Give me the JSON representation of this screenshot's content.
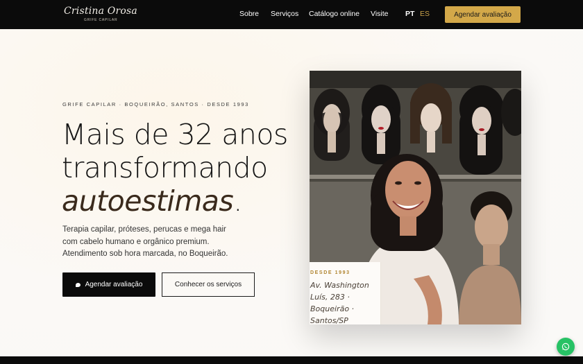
{
  "brand": {
    "name": "Cristina Orosa",
    "tagline": "GRIFE CAPILAR"
  },
  "nav": {
    "items": [
      {
        "label": "Sobre"
      },
      {
        "label": "Serviços"
      },
      {
        "label": "Catálogo online"
      },
      {
        "label": "Visite"
      }
    ],
    "languages": [
      {
        "label": "PT",
        "active": true
      },
      {
        "label": "ES",
        "active": false
      }
    ],
    "cta_label": "Agendar avaliação"
  },
  "hero": {
    "eyebrow": "GRIFE CAPILAR · BOQUEIRÃO, SANTOS · DESDE 1993",
    "headline_line1": "Mais de 32 anos",
    "headline_line2": "transformando",
    "headline_emphasis": "autoestimas",
    "headline_end": ".",
    "description_lines": [
      "Terapia capilar, próteses, perucas e mega hair",
      "com cabelo humano e orgânico premium.",
      "Atendimento sob hora marcada, no Boqueirão."
    ],
    "primary_button": "Agendar avaliação",
    "secondary_button": "Conhecer os serviços"
  },
  "photo_card": {
    "eyebrow": "DESDE 1993",
    "address_lines": [
      "Av. Washington",
      "Luís, 283 ·",
      "Boqueirão ·",
      "Santos/SP"
    ]
  },
  "colors": {
    "header_bg": "#0b0b0b",
    "accent_gold": "#d3a849",
    "whatsapp_green": "#27c265"
  },
  "icons": {
    "chat": "chat-bubble-icon",
    "whatsapp": "whatsapp-icon"
  }
}
